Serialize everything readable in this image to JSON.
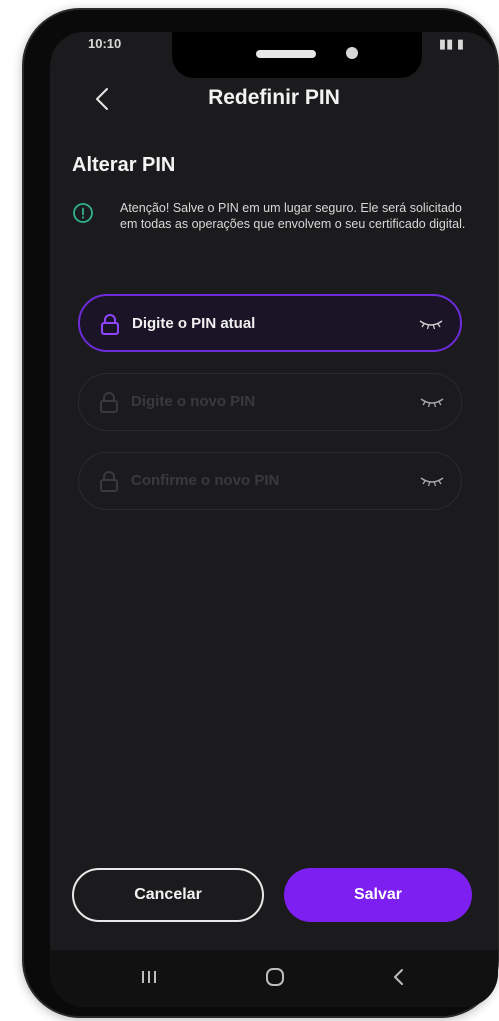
{
  "status_bar": {
    "time": "10:10",
    "right": "▮▮ ▮"
  },
  "header": {
    "title": "Redefinir PIN"
  },
  "section": {
    "title": "Alterar PIN"
  },
  "alert": {
    "text": "Atenção! Salve o PIN em um lugar seguro. Ele será solicitado em todas as operações que envolvem o seu certificado digital."
  },
  "fields": [
    {
      "placeholder": "Digite o PIN atual",
      "state": "active"
    },
    {
      "placeholder": "Digite o novo PIN",
      "state": "disabled"
    },
    {
      "placeholder": "Confirme o novo PIN",
      "state": "disabled"
    }
  ],
  "buttons": {
    "cancel": "Cancelar",
    "save": "Salvar"
  },
  "colors": {
    "accent": "#7c1ff0",
    "active_border": "#6d2bd9",
    "info_green": "#2fb38a",
    "background": "#1b1b1d"
  },
  "icons": {
    "back": "chevron-left-icon",
    "info": "info-circle-icon",
    "lock": "lock-icon",
    "eye": "eye-closed-icon",
    "nav_recents": "recents-icon",
    "nav_home": "home-icon",
    "nav_back": "chevron-left-icon"
  }
}
